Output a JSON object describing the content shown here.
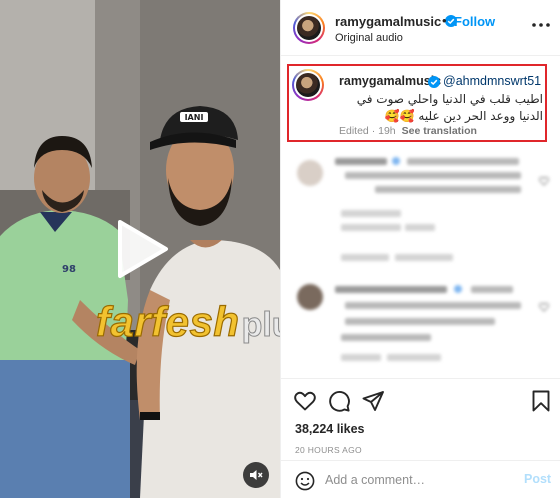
{
  "media": {
    "type": "video",
    "play_icon": "play-icon",
    "mute_icon": "speaker-muted-icon",
    "cap_text": "IANI",
    "shirt_text": "98"
  },
  "watermark": {
    "part1": "farfesh",
    "part2": "plus.com",
    "colors": {
      "primary": "#f2c230",
      "secondary": "#eaeaea"
    }
  },
  "header": {
    "username": "ramygamalmusic",
    "verified": true,
    "separator": "•",
    "follow_label": "Follow",
    "audio": "Original audio",
    "more_icon": "more-horizontal-icon"
  },
  "caption": {
    "username": "ramygamalmusic",
    "mention": "@ahmdmnswrt51",
    "text": "اطيب قلب في الدنيا واحلي صوت في الدنيا ووعد الحر دين عليه 🥰🥰",
    "edited": "Edited · 19h",
    "see_translation": "See translation"
  },
  "actions": {
    "like_icon": "heart-icon",
    "comment_icon": "comment-icon",
    "share_icon": "send-icon",
    "save_icon": "bookmark-icon"
  },
  "likes": "38,224 likes",
  "time_ago": "20 HOURS AGO",
  "comment_box": {
    "placeholder": "Add a comment…",
    "post_label": "Post",
    "emoji_icon": "emoji-icon"
  },
  "colors": {
    "follow_blue": "#0095f6",
    "post_disabled": "#b2dffc",
    "highlight_red": "#e0262b",
    "verified_blue": "#0095f6"
  }
}
